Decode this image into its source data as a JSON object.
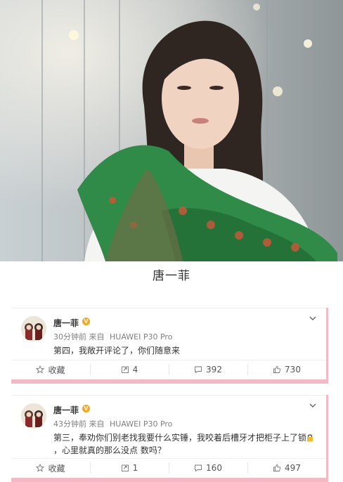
{
  "photo": {
    "caption": "唐一菲"
  },
  "posts": [
    {
      "author": "唐一菲",
      "time": "30分钟前",
      "source_prefix": "来自",
      "device": "HUAWEI P30 Pro",
      "text_line1": "第四，我敞开评论了，你们随意来",
      "text_line2": "",
      "actions": {
        "favorite_label": "收藏",
        "forward_count": "4",
        "comment_count": "392",
        "like_count": "730"
      }
    },
    {
      "author": "唐一菲",
      "time": "43分钟前",
      "source_prefix": "来自",
      "device": "HUAWEI P30 Pro",
      "text_line1": "第三，奉劝你们别老找我要什么实锤，我咬着后槽牙才把柜子上了锁",
      "text_line2": "，心里就真的那么没点  数吗？",
      "actions": {
        "favorite_label": "收藏",
        "forward_count": "1",
        "comment_count": "160",
        "like_count": "497"
      }
    }
  ],
  "colors": {
    "accent_pink": "#f2bac5",
    "vip_orange": "#f5a623",
    "meta_gray": "#808080"
  },
  "icons": [
    "chevron-down-icon",
    "star-icon",
    "forward-icon",
    "comment-icon",
    "like-icon",
    "lock-emoji-icon",
    "verified-badge-icon"
  ]
}
